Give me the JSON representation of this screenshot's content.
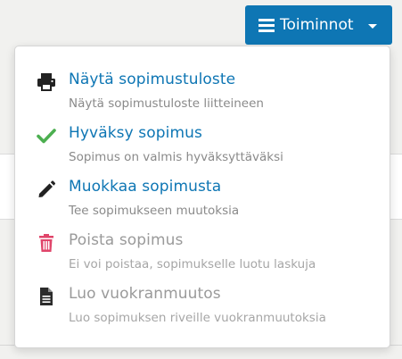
{
  "toolbar": {
    "actions_label": "Toiminnot",
    "menu_icon": "hamburger-icon",
    "caret_icon": "caret-down-icon",
    "accent_color": "#0e76b4"
  },
  "menu": {
    "items": [
      {
        "title": "Näytä sopimustuloste",
        "description": "Näytä sopimustuloste liitteineen",
        "icon": "print-icon",
        "enabled": true
      },
      {
        "title": "Hyväksy sopimus",
        "description": "Sopimus on valmis hyväksyttäväksi",
        "icon": "check-icon",
        "enabled": true,
        "icon_color": "#4caf50"
      },
      {
        "title": "Muokkaa sopimusta",
        "description": "Tee sopimukseen muutoksia",
        "icon": "pencil-icon",
        "enabled": true
      },
      {
        "title": "Poista sopimus",
        "description": "Ei voi poistaa, sopimukselle luotu laskuja",
        "icon": "trash-icon",
        "enabled": false,
        "icon_color": "#e0456a"
      },
      {
        "title": "Luo vuokranmuutos",
        "description": "Luo sopimuksen riveille vuokranmuutoksia",
        "icon": "document-icon",
        "enabled": false
      }
    ]
  }
}
